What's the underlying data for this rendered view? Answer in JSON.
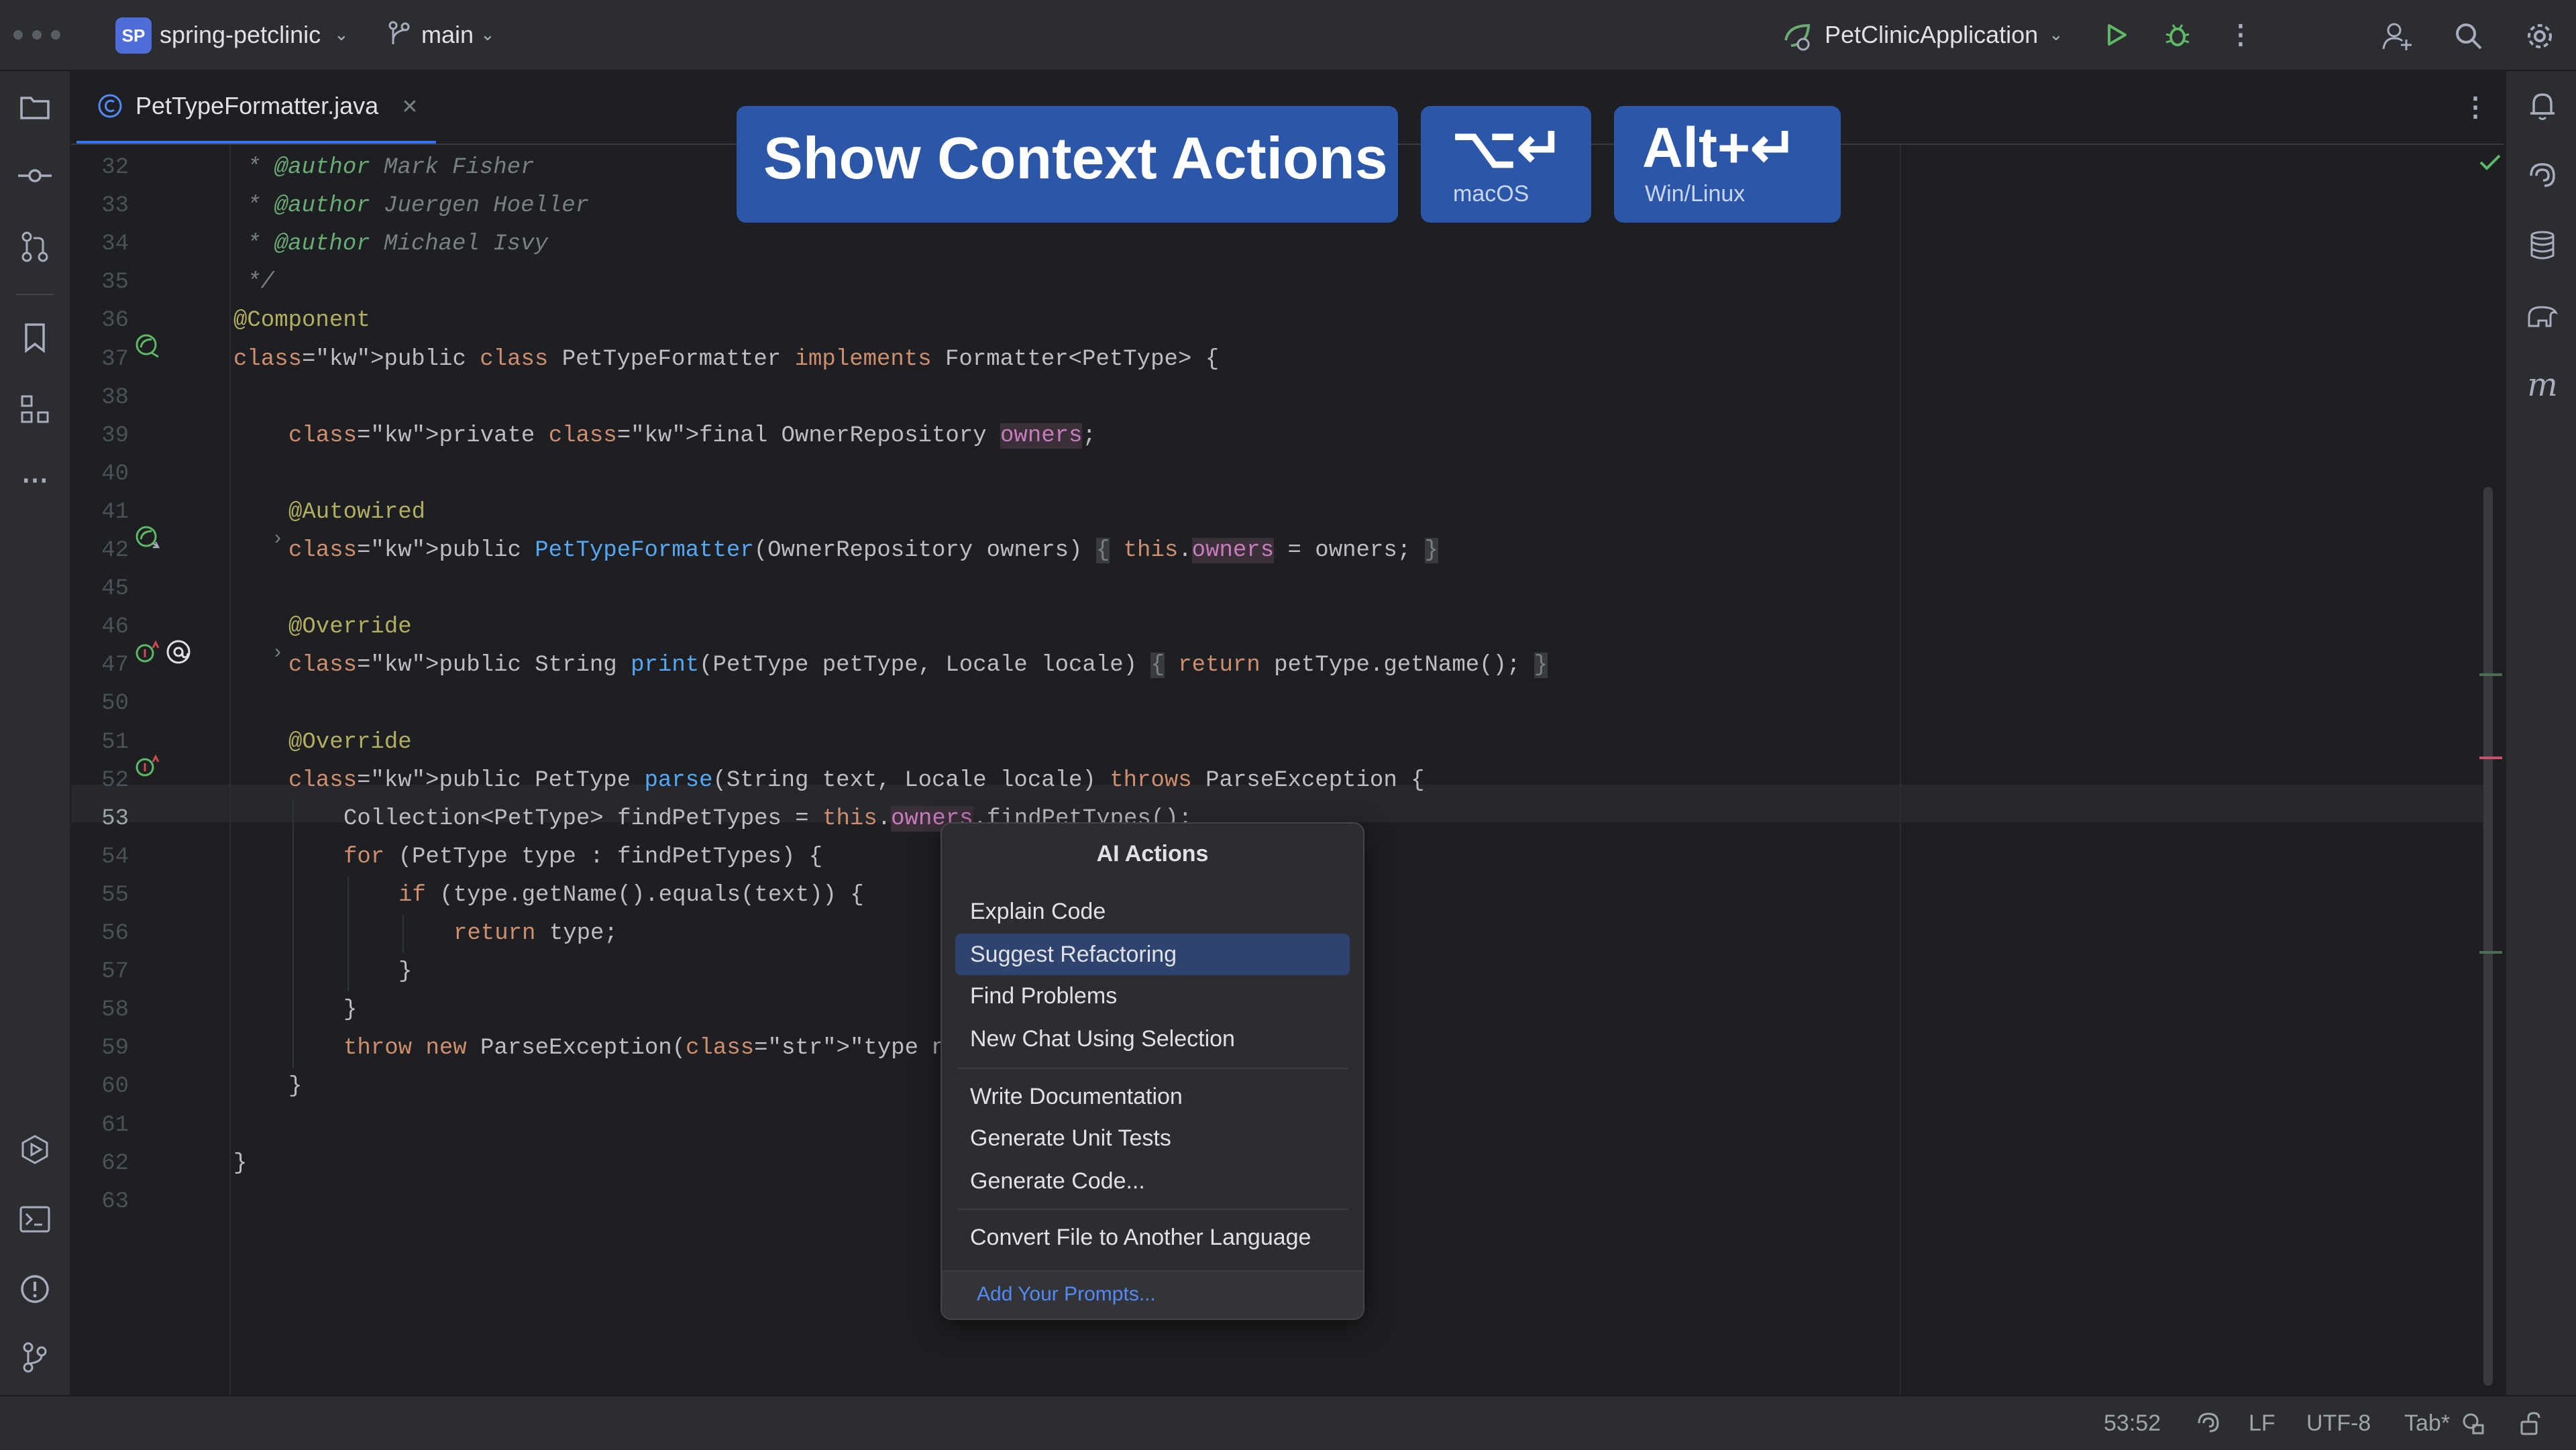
{
  "titlebar": {
    "project_badge": "SP",
    "project_name": "spring-petclinic",
    "branch": "main",
    "run_config": "PetClinicApplication"
  },
  "tab": {
    "file_name": "PetTypeFormatter.java"
  },
  "overlay": {
    "action_title": "Show Context Actions",
    "mac_keys": "⌥↵",
    "mac_label": "macOS",
    "win_keys": "Alt+↵",
    "win_label": "Win/Linux"
  },
  "editor": {
    "current_line": 53,
    "lines": [
      {
        "n": "32",
        "t": "* @author Mark Fisher"
      },
      {
        "n": "33",
        "t": "* @author Juergen Hoeller"
      },
      {
        "n": "34",
        "t": "* @author Michael Isvy"
      },
      {
        "n": "35",
        "t": "*/"
      },
      {
        "n": "36",
        "t": "@Component"
      },
      {
        "n": "37",
        "t": "public class PetTypeFormatter implements Formatter<PetType> {"
      },
      {
        "n": "38",
        "t": ""
      },
      {
        "n": "39",
        "t": "private final OwnerRepository owners;"
      },
      {
        "n": "40",
        "t": ""
      },
      {
        "n": "41",
        "t": "@Autowired"
      },
      {
        "n": "42",
        "t": "public PetTypeFormatter(OwnerRepository owners) { this.owners = owners; }"
      },
      {
        "n": "45",
        "t": ""
      },
      {
        "n": "46",
        "t": "@Override"
      },
      {
        "n": "47",
        "t": "public String print(PetType petType, Locale locale) { return petType.getName(); }"
      },
      {
        "n": "50",
        "t": ""
      },
      {
        "n": "51",
        "t": "@Override"
      },
      {
        "n": "52",
        "t": "public PetType parse(String text, Locale locale) throws ParseException {"
      },
      {
        "n": "53",
        "t": "Collection<PetType> findPetTypes = this.owners.findPetTypes();"
      },
      {
        "n": "54",
        "t": "for (PetType type : findPetTypes) {"
      },
      {
        "n": "55",
        "t": "if (type.getName().equals(text)) {"
      },
      {
        "n": "56",
        "t": "return type;"
      },
      {
        "n": "57",
        "t": "}"
      },
      {
        "n": "58",
        "t": "}"
      },
      {
        "n": "59",
        "t": "throw new ParseException(\"type not found: \""
      },
      {
        "n": "60",
        "t": "}"
      },
      {
        "n": "61",
        "t": ""
      },
      {
        "n": "62",
        "t": "}"
      },
      {
        "n": "63",
        "t": ""
      }
    ]
  },
  "popup": {
    "title": "AI Actions",
    "items": [
      {
        "label": "Explain Code"
      },
      {
        "label": "Suggest Refactoring"
      },
      {
        "label": "Find Problems"
      },
      {
        "label": "New Chat Using Selection"
      },
      {
        "label": "Write Documentation"
      },
      {
        "label": "Generate Unit Tests"
      },
      {
        "label": "Generate Code..."
      },
      {
        "label": "Convert File to Another Language"
      }
    ],
    "selected_index": 1,
    "footer_link": "Add Your Prompts..."
  },
  "statusbar": {
    "position": "53:52",
    "line_separator": "LF",
    "encoding": "UTF-8",
    "indent": "Tab*"
  },
  "colors": {
    "accent": "#2c57a8",
    "selection": "#2e436e",
    "link": "#548af7"
  }
}
